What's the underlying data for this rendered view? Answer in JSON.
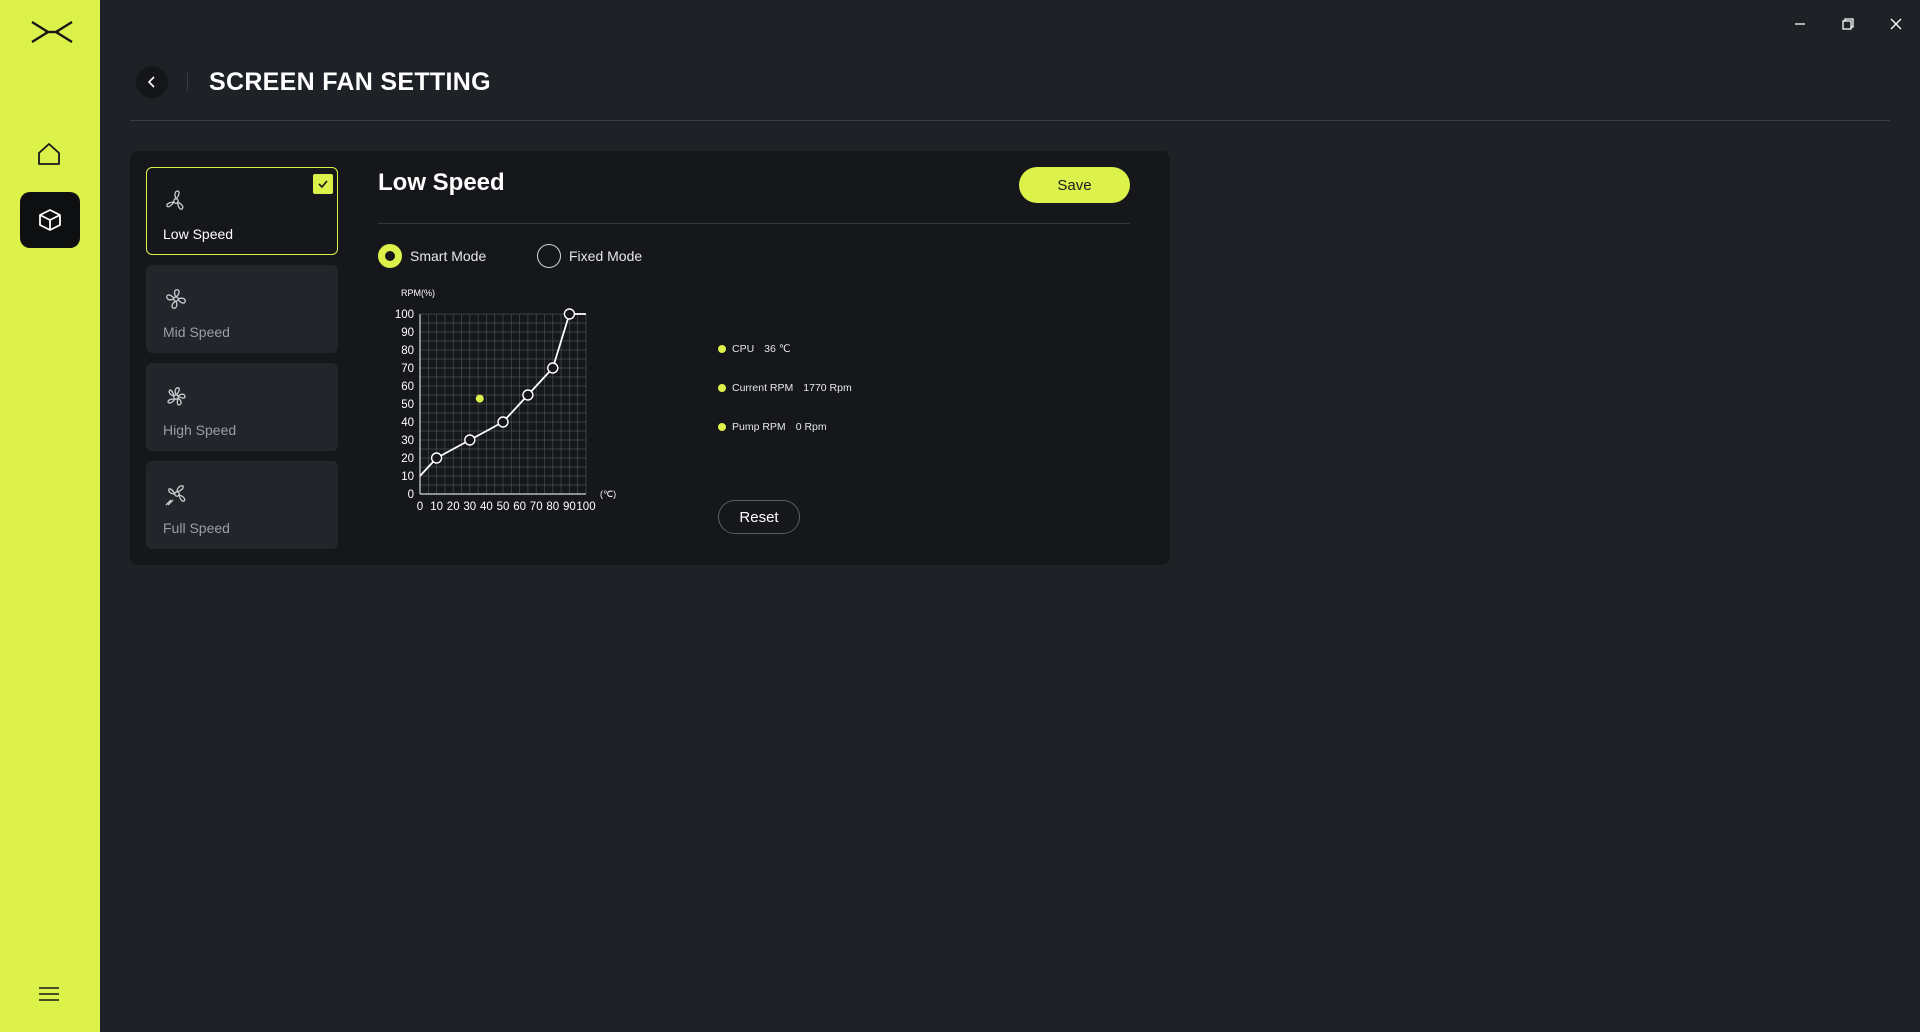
{
  "header": {
    "title": "SCREEN FAN SETTING"
  },
  "modes": [
    {
      "label": "Low Speed",
      "icon": "fan-low-icon",
      "active": true
    },
    {
      "label": "Mid Speed",
      "icon": "fan-mid-icon",
      "active": false
    },
    {
      "label": "High Speed",
      "icon": "fan-high-icon",
      "active": false
    },
    {
      "label": "Full Speed",
      "icon": "fan-full-icon",
      "active": false
    }
  ],
  "detail": {
    "title": "Low Speed",
    "save_label": "Save",
    "reset_label": "Reset",
    "radio_smart": "Smart Mode",
    "radio_fixed": "Fixed Mode",
    "selected_mode": "Smart Mode"
  },
  "stats": {
    "cpu_label": "CPU",
    "cpu_value": "36 ℃",
    "rpm_label": "Current RPM",
    "rpm_value": "1770 Rpm",
    "pump_label": "Pump RPM",
    "pump_value": "0 Rpm"
  },
  "colors": {
    "accent": "#dcf24b",
    "background": "#1e2126",
    "panel": "#15171a"
  },
  "chart_data": {
    "type": "line",
    "ylabel": "RPM(%)",
    "xlabel": "(℃)",
    "xlim": [
      0,
      100
    ],
    "ylim": [
      0,
      100
    ],
    "x_ticks": [
      0,
      10,
      20,
      30,
      40,
      50,
      60,
      70,
      80,
      90,
      100
    ],
    "y_ticks": [
      0,
      10,
      20,
      30,
      40,
      50,
      60,
      70,
      80,
      90,
      100
    ],
    "grid": true,
    "series": [
      {
        "x": [
          0,
          10,
          30,
          50,
          65,
          80,
          90,
          100
        ],
        "y": [
          10,
          20,
          30,
          40,
          55,
          70,
          100,
          100
        ],
        "control_points": [
          10,
          30,
          50,
          65,
          80,
          90
        ]
      }
    ],
    "current_point": {
      "x": 36,
      "y": 53
    }
  }
}
